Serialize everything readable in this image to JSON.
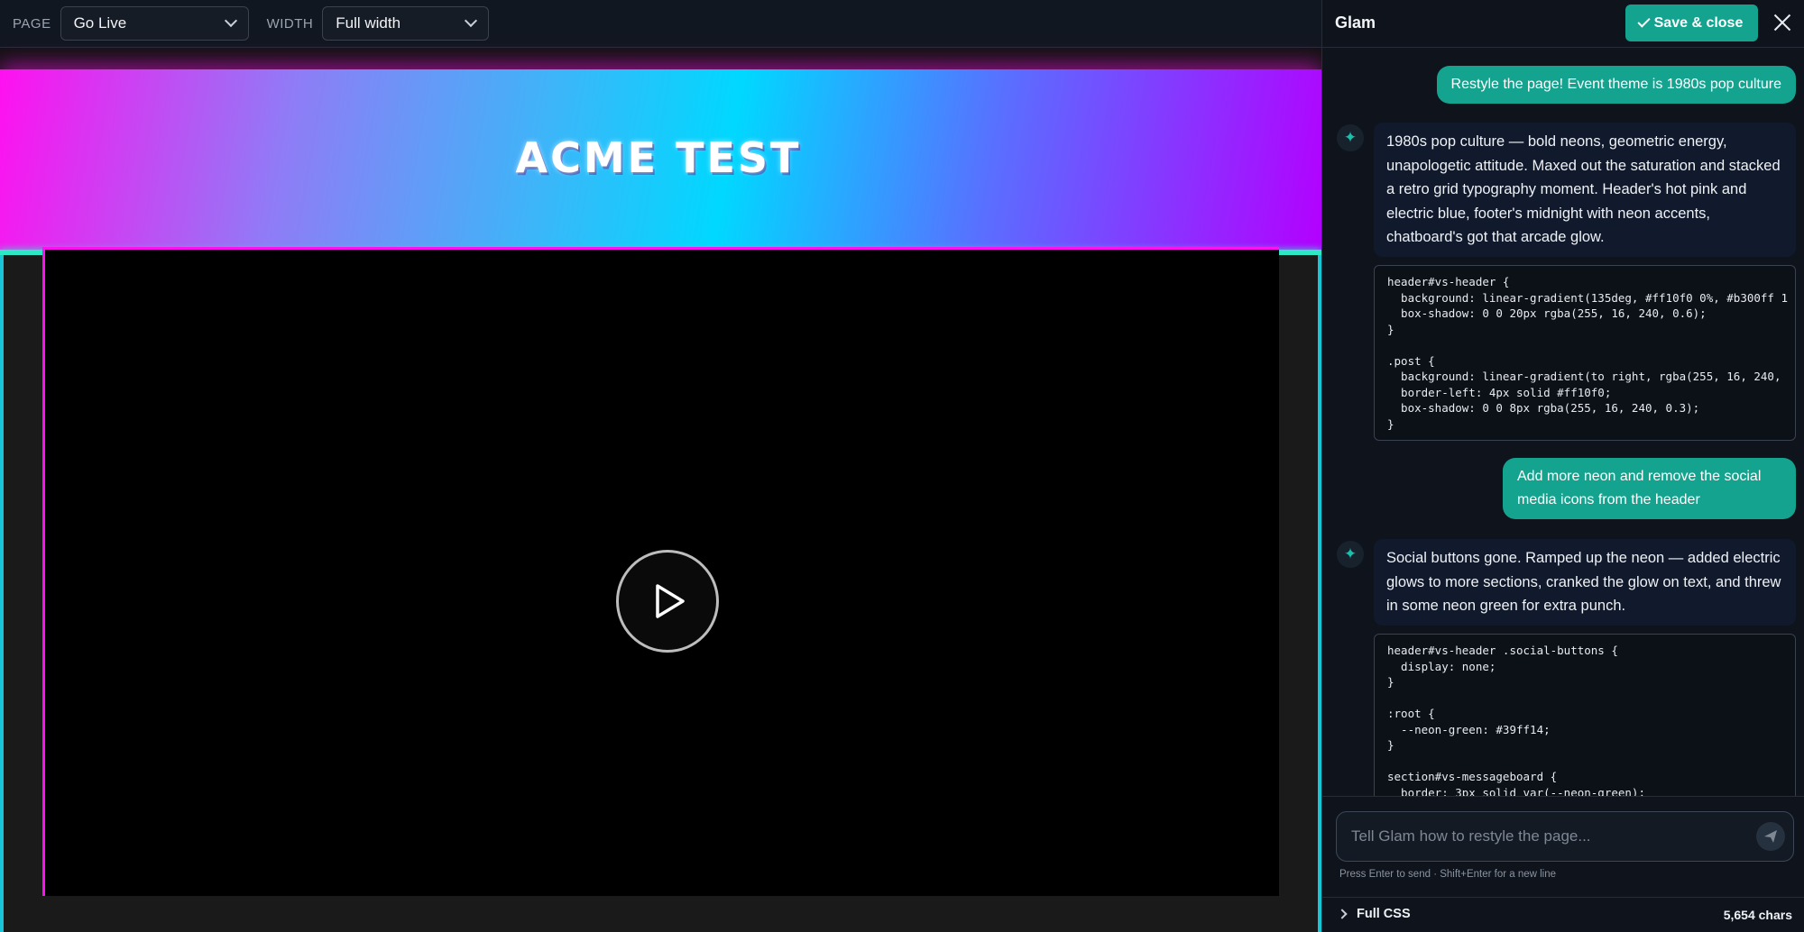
{
  "toolbar": {
    "page_label": "PAGE",
    "page_value": "Go Live",
    "width_label": "WIDTH",
    "width_value": "Full width"
  },
  "preview": {
    "site_title": "ACME TEST",
    "colors": {
      "header_pink": "#ff10f0",
      "header_blue": "#00d8ff",
      "header_purple": "#b300ff",
      "neon_green": "#2ee8c5",
      "frame_cyan": "#19c6d8"
    }
  },
  "panel": {
    "title": "Glam",
    "save_label": "Save & close",
    "accent": "#14a38f"
  },
  "messages": [
    {
      "role": "user",
      "text": "Restyle the page! Event theme is 1980s pop culture"
    },
    {
      "role": "assistant",
      "text": "1980s pop culture — bold neons, geometric energy, unapologetic attitude. Maxed out the saturation and stacked a retro grid typography moment. Header's hot pink and electric blue, footer's midnight with neon accents, chatboard's got that arcade glow."
    },
    {
      "role": "code",
      "text": "header#vs-header {\n  background: linear-gradient(135deg, #ff10f0 0%, #b300ff 1\n  box-shadow: 0 0 20px rgba(255, 16, 240, 0.6);\n}\n\n.post {\n  background: linear-gradient(to right, rgba(255, 16, 240,\n  border-left: 4px solid #ff10f0;\n  box-shadow: 0 0 8px rgba(255, 16, 240, 0.3);\n}"
    },
    {
      "role": "user",
      "text": "Add more neon and remove the social media icons from the header"
    },
    {
      "role": "assistant",
      "text": "Social buttons gone. Ramped up the neon — added electric glows to more sections, cranked the glow on text, and threw in some neon green for extra punch."
    },
    {
      "role": "code",
      "text": "header#vs-header .social-buttons {\n  display: none;\n}\n\n:root {\n  --neon-green: #39ff14;\n}\n\nsection#vs-messageboard {\n  border: 3px solid var(--neon-green);"
    }
  ],
  "composer": {
    "placeholder": "Tell Glam how to restyle the page...",
    "hint": "Press Enter to send · Shift+Enter for a new line"
  },
  "footer": {
    "css_label": "Full CSS",
    "char_count": "5,654 chars"
  },
  "icons": [
    "chevron-down-icon",
    "play-icon",
    "check-icon",
    "close-icon",
    "sparkle-icon",
    "send-icon",
    "chevron-right-icon"
  ]
}
